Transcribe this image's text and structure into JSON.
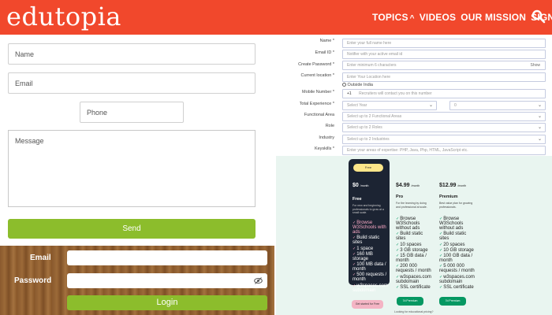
{
  "header": {
    "logo": "edutopia",
    "nav": [
      "TOPICS",
      "VIDEOS",
      "OUR MISSION",
      "SIGN UP"
    ],
    "colors": {
      "bar": "#f1482c"
    }
  },
  "contact_form": {
    "name_placeholder": "Name",
    "email_placeholder": "Email",
    "phone_placeholder": "Phone",
    "message_placeholder": "Message",
    "send_label": "Send",
    "accent": "#8cbd2c"
  },
  "login_form": {
    "email_label": "Email",
    "password_label": "Password",
    "login_label": "Login"
  },
  "registration_form": {
    "fields": [
      {
        "label": "Name *",
        "placeholder": "Enter your full name here"
      },
      {
        "label": "Email ID *",
        "placeholder": "Notifier with your active email id"
      },
      {
        "label": "Create Password *",
        "placeholder": "Enter minimum 6 characters",
        "extra": "Show"
      },
      {
        "label": "Current location *",
        "placeholder": "Enter Your Location here"
      },
      {
        "label": "",
        "placeholder": "Outside India"
      },
      {
        "label": "Mobile Number *",
        "prefix": "+1",
        "placeholder": "Recruiters will contact you on this number"
      },
      {
        "label": "Total Experience *",
        "placeholder": "Select Year",
        "second": "0"
      },
      {
        "label": "Functional Area",
        "placeholder": "Select up to 2 Functional Areas"
      },
      {
        "label": "Role",
        "placeholder": "Select up to 2 Roles"
      },
      {
        "label": "Industry",
        "placeholder": "Select up to 2 Industries"
      },
      {
        "label": "Keyskills *",
        "placeholder": "Enter your areas of expertise: PHP, Java, Php, HTML, JavaScript etc."
      }
    ]
  },
  "pricing": {
    "plans": [
      {
        "tag": "Free",
        "price": "$0",
        "period": "/month",
        "name": "Free",
        "desc": "For new and beginning professionals to grow at a small scale.",
        "features": [
          "Browse W3Schools with ads",
          "Build static sites",
          "1 space",
          "160 MB storage",
          "100 MB data / month",
          "500 requests / month",
          "w3spaces.com subdomain"
        ],
        "button": "Get started for Free"
      },
      {
        "price": "$4.99",
        "period": "/month",
        "name": "Pro",
        "desc": "For the learning by doing and professional at scale.",
        "features": [
          "Browse W3Schools without ads",
          "Build static sites",
          "10 spaces",
          "3 GB storage",
          "15 GB data / month",
          "200 000 requests / month",
          "w3spaces.com subdomain",
          "SSL certificate"
        ],
        "button": "7d Premium"
      },
      {
        "price": "$12.99",
        "period": "/month",
        "name": "Premium",
        "desc": "Best value plan for growing professionals.",
        "features": [
          "Browse W3Schools without ads",
          "Build static sites",
          "20 spaces",
          "10 GB storage",
          "100 GB data / month",
          "5 000 000 requests / month",
          "w3spaces.com subdomain",
          "SSL certificate"
        ],
        "button": "7d Premium"
      }
    ],
    "footnote": "Looking for educational pricing?"
  }
}
